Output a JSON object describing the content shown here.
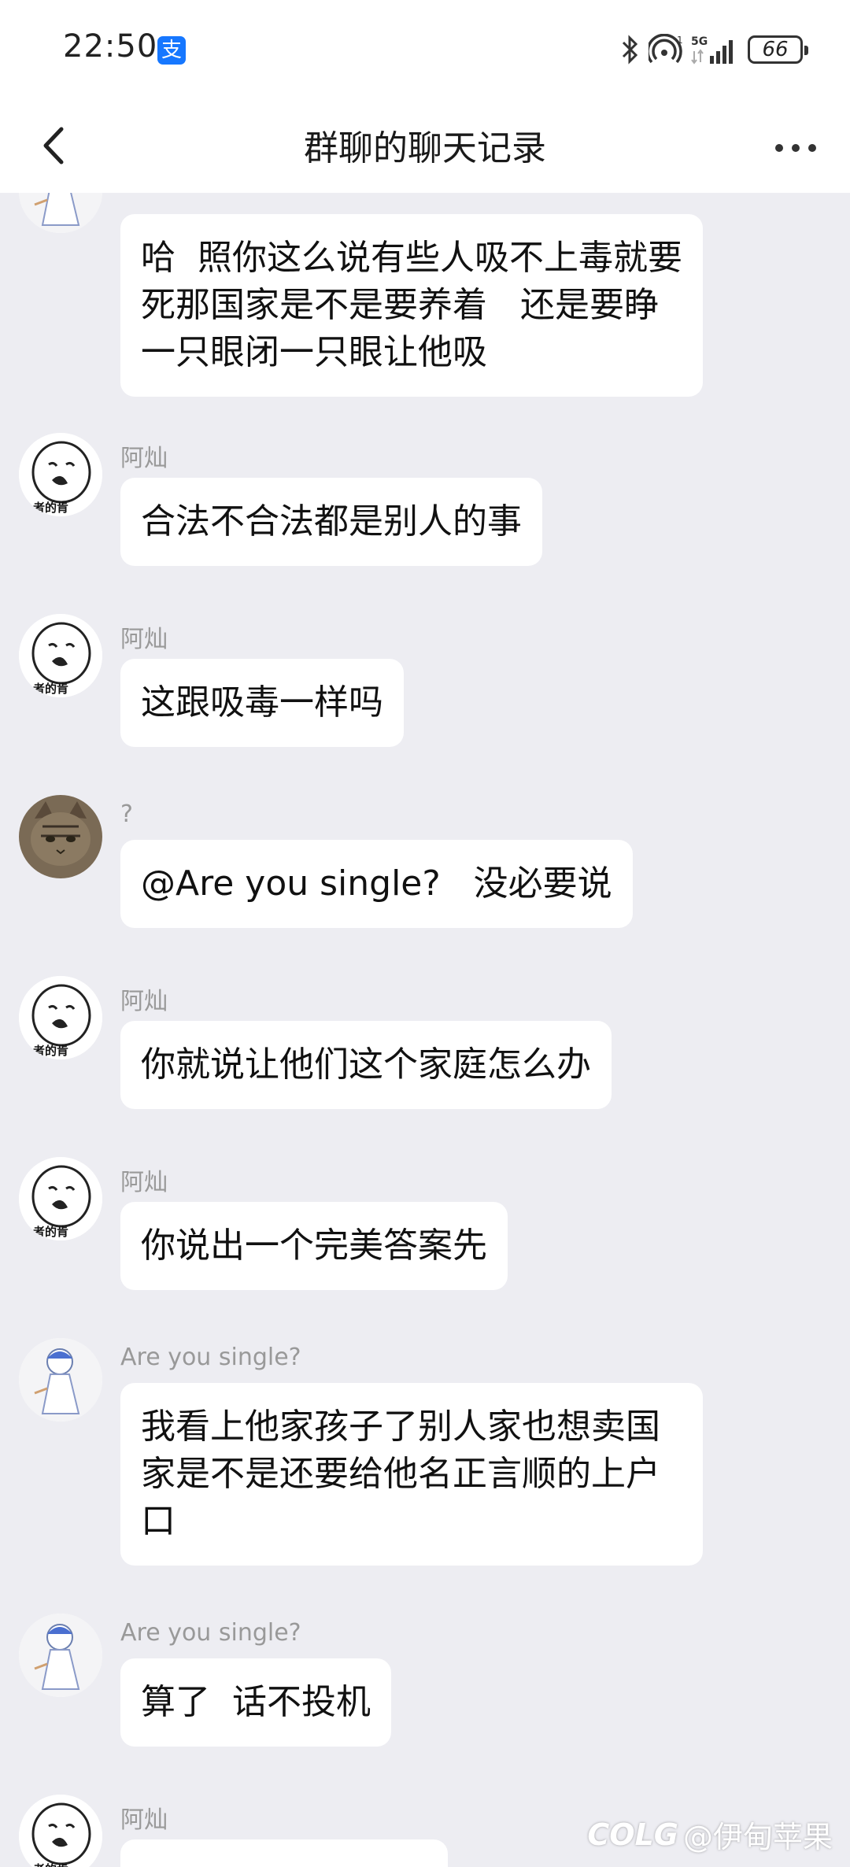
{
  "status_bar": {
    "time": "22:50",
    "pay_icon_label": "支",
    "battery": "66",
    "icons": [
      "bluetooth-icon",
      "hotspot-icon",
      "signal-5g-icon",
      "battery-icon"
    ]
  },
  "nav": {
    "title": "群聊的聊天记录",
    "back_icon": "chevron-left-icon",
    "more_icon": "more-dots-icon"
  },
  "messages": [
    {
      "sender": "",
      "avatar": "anime-girl-avatar",
      "text": "哈  照你这么说有些人吸不上毒就要死那国家是不是要养着   还是要睁一只眼闭一只眼让他吸"
    },
    {
      "sender": "阿灿",
      "avatar": "meme-face-avatar",
      "text": "合法不合法都是别人的事"
    },
    {
      "sender": "阿灿",
      "avatar": "meme-face-avatar",
      "text": "这跟吸毒一样吗"
    },
    {
      "sender": "?",
      "avatar": "cat-avatar",
      "text": "@Are you single?   没必要说"
    },
    {
      "sender": "阿灿",
      "avatar": "meme-face-avatar",
      "text": "你就说让他们这个家庭怎么办"
    },
    {
      "sender": "阿灿",
      "avatar": "meme-face-avatar",
      "text": "你说出一个完美答案先"
    },
    {
      "sender": "Are you single?",
      "avatar": "anime-girl-avatar",
      "text": "我看上他家孩子了别人家也想卖国家是不是还要给他名正言顺的上户口"
    },
    {
      "sender": "Are you single?",
      "avatar": "anime-girl-avatar",
      "text": "算了  话不投机"
    },
    {
      "sender": "阿灿",
      "avatar": "meme-face-avatar",
      "text": ""
    }
  ],
  "meme_avatar_caption": "者的肯",
  "watermark": {
    "logo": "COLG",
    "text": "@伊甸苹果"
  }
}
